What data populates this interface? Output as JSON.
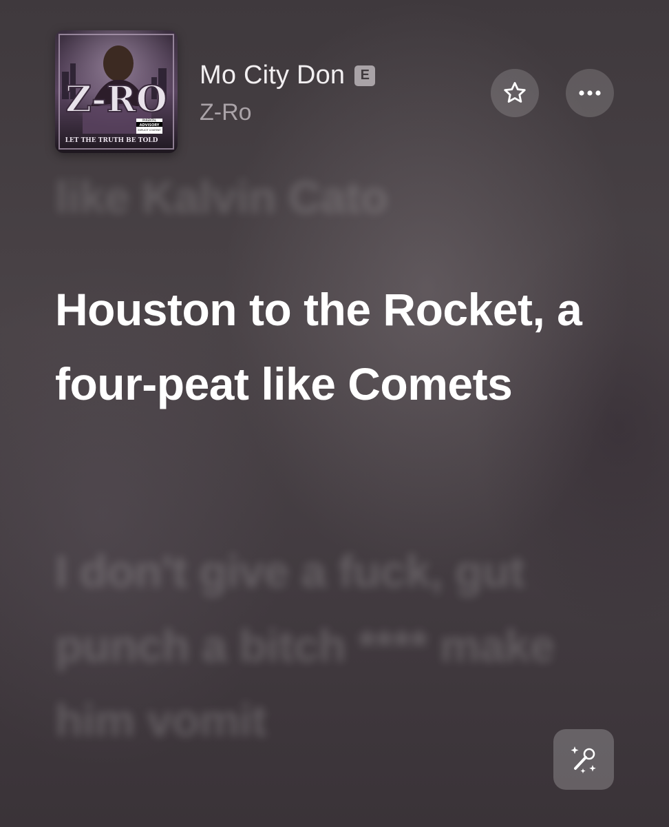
{
  "now_playing": {
    "title": "Mo City Don",
    "explicit_badge": "E",
    "artist": "Z-Ro",
    "album_art_text": {
      "logo": "Z-RO",
      "tagline": "LET THE TRUTH BE TOLD",
      "advisory_line1": "PARENTAL",
      "advisory_line2": "ADVISORY",
      "advisory_line3": "EXPLICIT CONTENT"
    }
  },
  "buttons": {
    "favorite_icon": "star-icon",
    "more_icon": "ellipsis-icon",
    "sing_icon": "microphone-sparkle-icon"
  },
  "lyrics": {
    "previous_line": "like Kalvin Cato",
    "current_line": "Houston to the Rocket, a four-peat like Comets",
    "next_line": "I don't give a fuck, gut punch a bitch **** make him vomit"
  },
  "colors": {
    "background": "#3b3438",
    "active_lyric": "#ffffff",
    "secondary_text": "#aaa3a8"
  }
}
